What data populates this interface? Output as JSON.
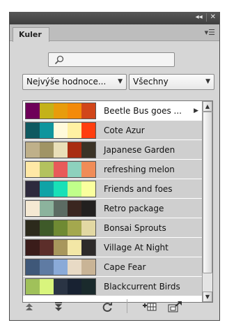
{
  "panel": {
    "tab_label": "Kuler",
    "titlebar_buttons": [
      "◂◂",
      "✕"
    ],
    "menu_icon": "panel-menu-icon"
  },
  "search": {
    "value": "",
    "placeholder": ""
  },
  "filters": {
    "sort": {
      "selected": "Nejvýše hodnoce..."
    },
    "scope": {
      "selected": "Všechny"
    }
  },
  "themes": [
    {
      "name": "Beetle Bus goes ...",
      "colors": [
        "#6e0059",
        "#c4b21a",
        "#e89c0c",
        "#f38a0a",
        "#d1461a"
      ],
      "selected": true
    },
    {
      "name": "Cote Azur",
      "colors": [
        "#0f5960",
        "#0f959d",
        "#fffadb",
        "#fff1a3",
        "#ff3e0f"
      ],
      "selected": false
    },
    {
      "name": "Japanese Garden",
      "colors": [
        "#bfb08a",
        "#a09465",
        "#e9dfb8",
        "#a92c12",
        "#3b3326"
      ],
      "selected": false
    },
    {
      "name": "refreshing melon",
      "colors": [
        "#ffe8a6",
        "#b3c25e",
        "#e85a5a",
        "#8dd1bd",
        "#f08c57"
      ],
      "selected": false
    },
    {
      "name": "Friends and foes",
      "colors": [
        "#2e2a3d",
        "#0fa3a6",
        "#19e0b7",
        "#c0ff8a",
        "#faff9e"
      ],
      "selected": false
    },
    {
      "name": "Retro package",
      "colors": [
        "#f5e9d3",
        "#8cb39d",
        "#5c6b63",
        "#3a2620",
        "#22201f"
      ],
      "selected": false
    },
    {
      "name": "Bonsai Sprouts",
      "colors": [
        "#2c2a1c",
        "#3e5a29",
        "#6f8a33",
        "#a4a84e",
        "#e2d8a3"
      ],
      "selected": false
    },
    {
      "name": "Village At Night",
      "colors": [
        "#3a1c1a",
        "#5c2e2a",
        "#a8975c",
        "#f3e7a6",
        "#2e2b2a"
      ],
      "selected": false
    },
    {
      "name": "Cape Fear",
      "colors": [
        "#3f5879",
        "#5f7ba3",
        "#8aaad8",
        "#e8dac5",
        "#c9b496"
      ],
      "selected": false
    },
    {
      "name": "Blackcurrent Birds",
      "colors": [
        "#a0c15a",
        "#d9f57d",
        "#2a3444",
        "#182232",
        "#1a2a2c"
      ],
      "selected": false
    }
  ],
  "scroll": {
    "position_fraction": 0.0,
    "visible_fraction": 0.9
  },
  "toolbar": {
    "buttons": [
      {
        "name": "move-up-button",
        "icon": "arrow-up-icon"
      },
      {
        "name": "move-down-button",
        "icon": "arrow-down-icon"
      },
      {
        "name": "refresh-button",
        "icon": "refresh-icon"
      },
      {
        "name": "add-to-swatches-button",
        "icon": "add-swatches-icon"
      },
      {
        "name": "upload-button",
        "icon": "upload-icon"
      }
    ]
  },
  "colors": {
    "titlebar": "#4a4a4a",
    "panel_bg": "#d6d6d6",
    "row_bg": "#cfcfcf",
    "row_selected_bg": "#ffffff"
  }
}
